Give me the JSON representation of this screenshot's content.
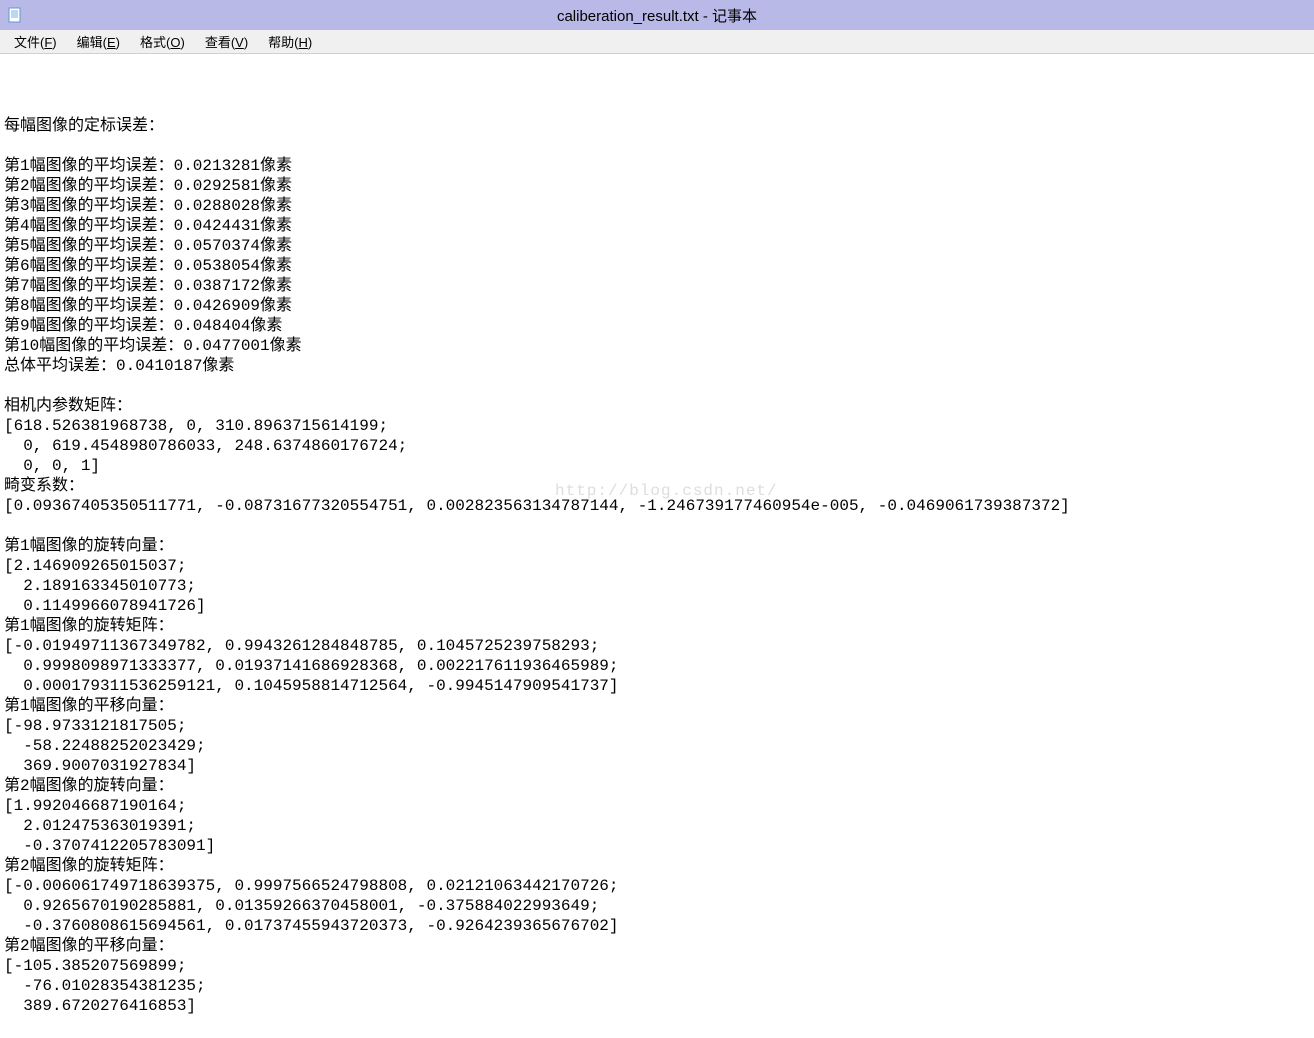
{
  "window": {
    "title": "caliberation_result.txt - 记事本"
  },
  "menu": {
    "file": "文件(F)",
    "edit": "编辑(E)",
    "format": "格式(O)",
    "view": "查看(V)",
    "help": "帮助(H)"
  },
  "watermark": "http://blog.csdn.net/",
  "body": "每幅图像的定标误差：\n\n第1幅图像的平均误差：0.0213281像素\n第2幅图像的平均误差：0.0292581像素\n第3幅图像的平均误差：0.0288028像素\n第4幅图像的平均误差：0.0424431像素\n第5幅图像的平均误差：0.0570374像素\n第6幅图像的平均误差：0.0538054像素\n第7幅图像的平均误差：0.0387172像素\n第8幅图像的平均误差：0.0426909像素\n第9幅图像的平均误差：0.048404像素\n第10幅图像的平均误差：0.0477001像素\n总体平均误差：0.0410187像素\n\n相机内参数矩阵：\n[618.526381968738, 0, 310.8963715614199;\n  0, 619.4548980786033, 248.6374860176724;\n  0, 0, 1]\n畸变系数：\n[0.09367405350511771, -0.08731677320554751, 0.002823563134787144, -1.246739177460954e-005, -0.0469061739387372]\n\n第1幅图像的旋转向量：\n[2.146909265015037;\n  2.189163345010773;\n  0.1149966078941726]\n第1幅图像的旋转矩阵：\n[-0.01949711367349782, 0.9943261284848785, 0.1045725239758293;\n  0.9998098971333377, 0.01937141686928368, 0.002217611936465989;\n  0.000179311536259121, 0.1045958814712564, -0.9945147909541737]\n第1幅图像的平移向量：\n[-98.9733121817505;\n  -58.22488252023429;\n  369.9007031927834]\n第2幅图像的旋转向量：\n[1.992046687190164;\n  2.012475363019391;\n  -0.3707412205783091]\n第2幅图像的旋转矩阵：\n[-0.006061749718639375, 0.9997566524798808, 0.02121063442170726;\n  0.9265670190285881, 0.01359266370458001, -0.375884022993649;\n  -0.3760808615694561, 0.01737455943720373, -0.9264239365676702]\n第2幅图像的平移向量：\n[-105.385207569899;\n  -76.01028354381235;\n  389.6720276416853]"
}
